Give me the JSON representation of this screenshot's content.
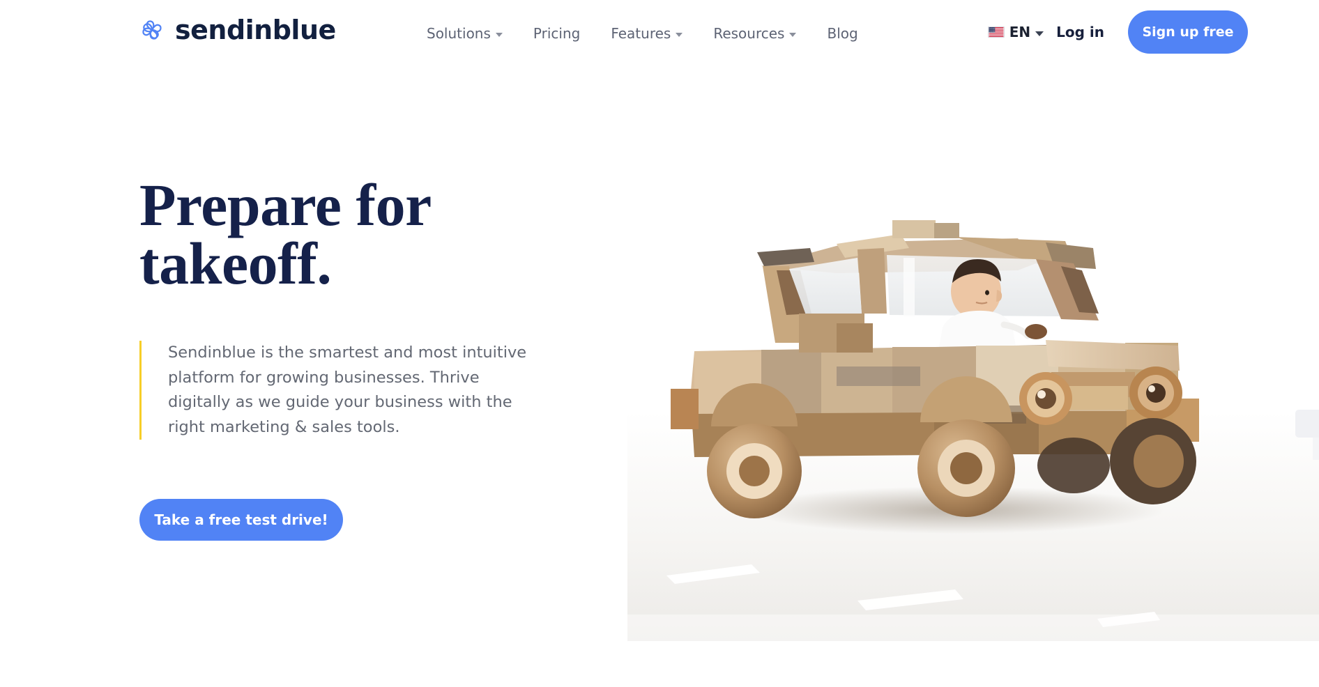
{
  "header": {
    "brand": {
      "name": "sendinblue",
      "icon": "sendinblue-pinwheel-logo",
      "color": "#5183f5"
    },
    "nav": [
      {
        "label": "Solutions",
        "has_dropdown": true
      },
      {
        "label": "Pricing",
        "has_dropdown": false
      },
      {
        "label": "Features",
        "has_dropdown": true
      },
      {
        "label": "Resources",
        "has_dropdown": true
      },
      {
        "label": "Blog",
        "has_dropdown": false
      }
    ],
    "language": {
      "code": "EN",
      "flag": "us-flag-icon",
      "has_dropdown": true
    },
    "login_label": "Log in",
    "signup_label": "Sign up free"
  },
  "hero": {
    "headline_line1": "Prepare for",
    "headline_line2": "takeoff.",
    "lede": "Sendinblue is the smartest and most intuitive platform for growing businesses. Thrive digitally as we guide your business with the right marketing & sales tools.",
    "cta_label": "Take a free test drive!",
    "image_alt": "wooden-block-toy-car-with-boy-driving"
  },
  "colors": {
    "accent_blue": "#5183f5",
    "headline_navy": "#15214a",
    "body_gray": "#636873",
    "accent_yellow": "#f7ce28",
    "nav_gray": "#5d6374"
  }
}
